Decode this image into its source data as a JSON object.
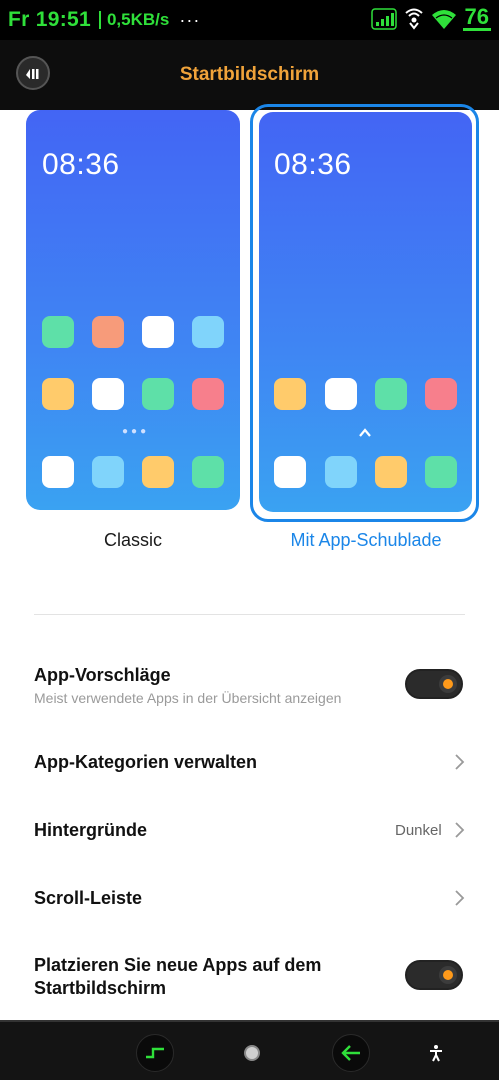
{
  "status_bar": {
    "time": "Fr 19:51",
    "speed": "0,5KB/s",
    "more": "···",
    "battery": "76",
    "accent_color": "#2fe03a"
  },
  "header": {
    "title": "Startbildschirm",
    "back_icon": "back-icon"
  },
  "previews": {
    "classic": {
      "clock": "08:36",
      "label": "Classic"
    },
    "drawer": {
      "clock": "08:36",
      "label": "Mit App-Schublade",
      "selected": true
    }
  },
  "settings": {
    "app_suggestions": {
      "title": "App-Vorschläge",
      "subtitle": "Meist verwendete Apps in der Übersicht anzeigen",
      "enabled": true
    },
    "manage_categories": {
      "title": "App-Kategorien verwalten"
    },
    "backgrounds": {
      "title": "Hintergründe",
      "value": "Dunkel"
    },
    "scrollbar": {
      "title": "Scroll-Leiste"
    },
    "place_new_apps": {
      "title_line1": "Platzieren Sie neue Apps auf dem",
      "title_line2": "Startbildschirm",
      "enabled": true
    }
  },
  "colors": {
    "accent_blue": "#1b86e8",
    "header_title": "#f0a33a",
    "toggle_knob": "#ff9a1a"
  }
}
